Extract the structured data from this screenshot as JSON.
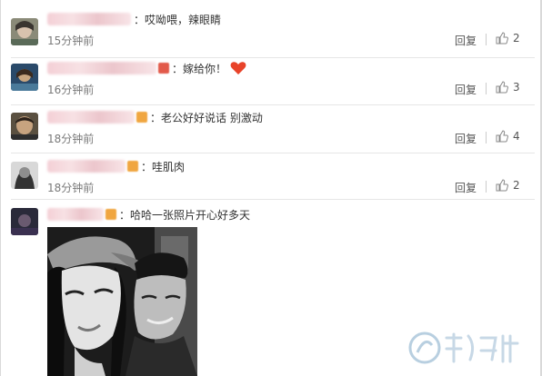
{
  "comments": [
    {
      "text": "哎呦喂，辣眼睛",
      "time": "15分钟前",
      "reply_label": "回复",
      "likes": "2"
    },
    {
      "text": "嫁给你！",
      "time": "16分钟前",
      "reply_label": "回复",
      "likes": "3"
    },
    {
      "text": "老公好好说话 别激动",
      "time": "18分钟前",
      "reply_label": "回复",
      "likes": "4"
    },
    {
      "text": "哇肌肉",
      "time": "18分钟前",
      "reply_label": "回复",
      "likes": "2"
    },
    {
      "text": "哈哈一张照片开心好多天"
    }
  ],
  "separator": "：",
  "icons": {
    "like": "thumbs-up-icon",
    "heart": "heart-emoji-icon"
  },
  "colors": {
    "heart": "#e8432a",
    "muted_text": "#7a7a7a",
    "divider": "#e6e6e6",
    "username_blur": "#f4d0d6"
  }
}
